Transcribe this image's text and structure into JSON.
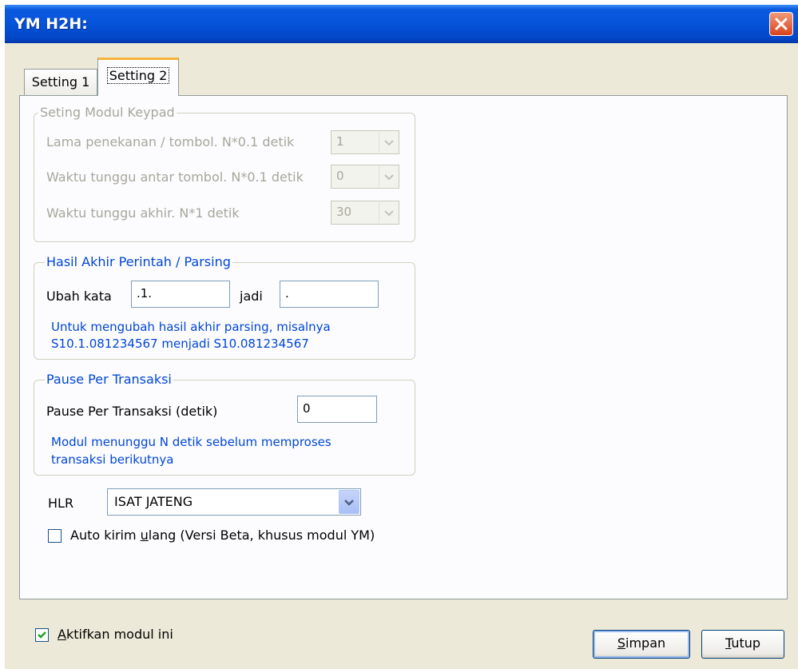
{
  "window": {
    "title": "YM H2H:"
  },
  "tabs": [
    {
      "label": "Setting 1",
      "active": false
    },
    {
      "label": "Setting 2",
      "active": true
    }
  ],
  "keypad_group": {
    "legend": "Seting Modul Keypad",
    "rows": [
      {
        "label": "Lama penekanan / tombol. N*0.1 detik",
        "value": "1"
      },
      {
        "label": "Waktu tunggu antar tombol. N*0.1 detik",
        "value": "0"
      },
      {
        "label": "Waktu tunggu akhir. N*1 detik",
        "value": "30"
      }
    ]
  },
  "parsing_group": {
    "legend": "Hasil Akhir Perintah / Parsing",
    "change_label": "Ubah kata",
    "from_value": ".1.",
    "to_label": "jadi",
    "to_value": ".",
    "hint_line1": "Untuk mengubah hasil akhir parsing, misalnya",
    "hint_line2": "S10.1.081234567 menjadi S10.081234567"
  },
  "pause_group": {
    "legend": "Pause Per Transaksi",
    "label": "Pause Per Transaksi (detik)",
    "value": "0",
    "hint_line1": "Modul menunggu N detik sebelum memproses",
    "hint_line2": "transaksi berikutnya"
  },
  "hlr": {
    "label": "HLR",
    "value": "ISAT JATENG"
  },
  "auto_resend": {
    "label_pre": "Auto kirim ",
    "label_u": "u",
    "label_post": "lang (Versi Beta, khusus modul YM)",
    "checked": false
  },
  "activate": {
    "label_u": "A",
    "label_post": "ktifkan modul ini",
    "checked": true
  },
  "buttons": {
    "save_u": "S",
    "save_rest": "impan",
    "close_u": "T",
    "close_rest": "utup"
  },
  "colors": {
    "titlebar": "#0553d8",
    "accent_blue": "#0046d5",
    "disabled_text": "#a7a69c",
    "tab_highlight": "#f7b43a"
  }
}
